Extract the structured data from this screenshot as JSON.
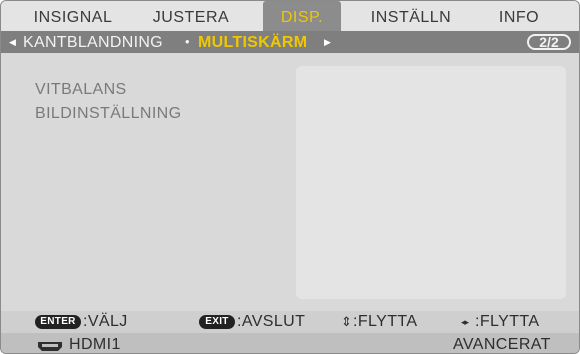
{
  "tabs": [
    {
      "label": "INSIGNAL",
      "active": false
    },
    {
      "label": "JUSTERA",
      "active": false
    },
    {
      "label": "DISP.",
      "active": true
    },
    {
      "label": "INSTÄLLN",
      "active": false
    },
    {
      "label": "INFO",
      "active": false
    }
  ],
  "subnav": {
    "left_arrow": "◀",
    "items": [
      "KANTBLANDNING",
      "MULTISKÄRM"
    ],
    "current": "MULTISKÄRM",
    "separator": "•",
    "right_arrow": "▶",
    "page": "2/2"
  },
  "menu": {
    "items": [
      "VITBALANS",
      "BILDINSTÄLLNING"
    ]
  },
  "help": {
    "enter_key": "ENTER",
    "enter_action": ":VÄLJ",
    "exit_key": "EXIT",
    "exit_action": ":AVSLUT",
    "updown_icon": "⇕",
    "updown_action": ":FLYTTA",
    "leftright_icon": "◂▸",
    "leftright_action": ":FLYTTA"
  },
  "status": {
    "input_icon": "hdmi-icon",
    "input": "HDMI1",
    "mode": "AVANCERAT"
  },
  "colors": {
    "active_tab_text": "#f0c800",
    "active_tab_bg": "#8c8c8c",
    "subnav_bg": "#7f7f7f",
    "current_subnav_text": "#f0c800",
    "panel_bg": "#d9d9d9"
  }
}
